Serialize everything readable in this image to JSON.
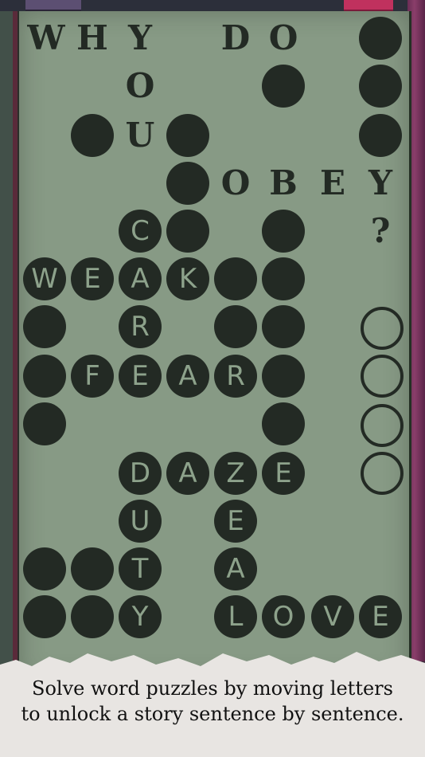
{
  "colors": {
    "paper": "#879a85",
    "ink": "#232a24",
    "tile_letter": "#8da28b",
    "caption_bg": "#e8e5e2",
    "accent_pink": "#c0315e",
    "accent_purple": "#5c4f72"
  },
  "typed_letters": [
    "W",
    "H",
    "Y",
    "D",
    "O",
    "O",
    "U",
    "O",
    "B",
    "E",
    "Y",
    "?"
  ],
  "tile_letters": [
    "C",
    "W",
    "E",
    "A",
    "K",
    "R",
    "F",
    "E",
    "A",
    "R",
    "D",
    "A",
    "Z",
    "E",
    "U",
    "E",
    "T",
    "A",
    "Y",
    "L",
    "O",
    "V",
    "E"
  ],
  "caption": {
    "line1": "Solve word puzzles by moving letters",
    "line2": "to unlock a story sentence by sentence."
  }
}
